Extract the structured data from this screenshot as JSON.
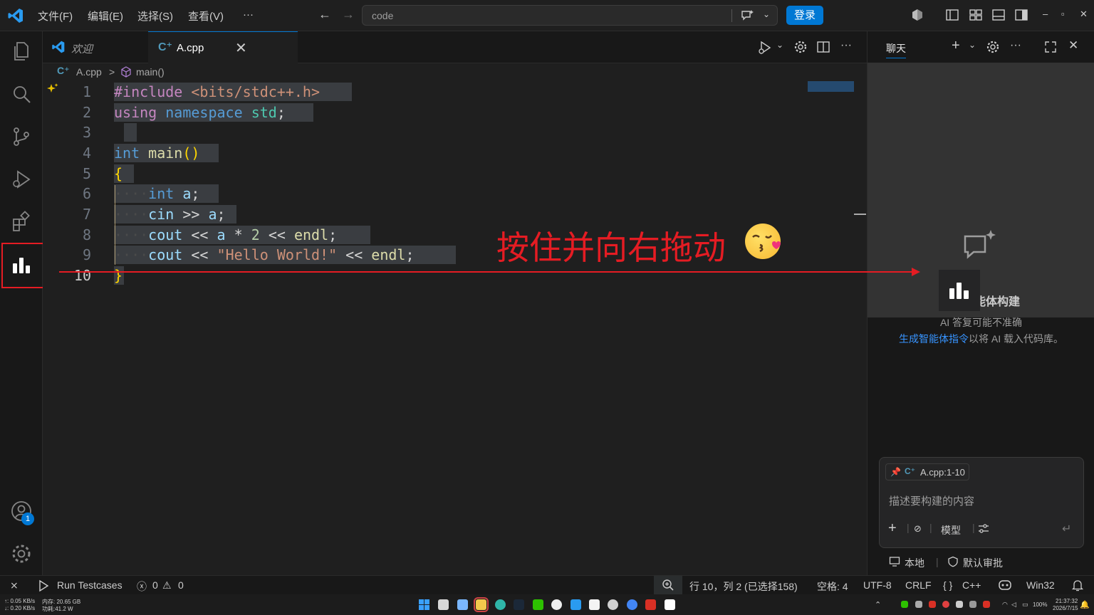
{
  "titlebar": {
    "menus": [
      "文件(F)",
      "编辑(E)",
      "选择(S)",
      "查看(V)"
    ],
    "more": "···",
    "search_placeholder": "code",
    "login_label": "登录",
    "window_controls": [
      "–",
      "▫",
      "✕"
    ]
  },
  "activitybar": {
    "items": [
      "explorer-icon",
      "search-icon",
      "source-control-icon",
      "run-debug-icon",
      "extensions-icon",
      "chart-icon"
    ],
    "account_badge": "1"
  },
  "tabs": [
    {
      "label": "欢迎",
      "active": false
    },
    {
      "label": "A.cpp",
      "active": true,
      "close": "✕"
    }
  ],
  "breadcrumb": {
    "file": "A.cpp",
    "sep": ">",
    "symbol": "main()"
  },
  "editor": {
    "line_numbers": [
      "1",
      "2",
      "3",
      "4",
      "5",
      "6",
      "7",
      "8",
      "9",
      "10"
    ],
    "code": {
      "l1a": "#include",
      "l1b": "<bits/stdc++.h>",
      "l2a": "using",
      "l2b": "namespace",
      "l2c": "std",
      "l2d": ";",
      "l4a": "int",
      "l4b": "main",
      "l4c": "()",
      "l5": "{",
      "l6a": "int",
      "l6b": "a",
      "l6c": ";",
      "l7a": "cin",
      "l7b": ">>",
      "l7c": "a",
      "l7d": ";",
      "l8a": "cout",
      "l8b": "<<",
      "l8c": "a",
      "l8d": "*",
      "l8e": "2",
      "l8f": "<<",
      "l8g": "endl",
      "l8h": ";",
      "l9a": "cout",
      "l9b": "<<",
      "l9c": "\"Hello World!\"",
      "l9d": "<<",
      "l9e": "endl",
      "l9f": ";",
      "l10": "}",
      "indent": "····"
    }
  },
  "annotation": {
    "text": "按住并向右拖动"
  },
  "chat": {
    "title": "聊天",
    "build_label": "使用智能体构建",
    "note": "AI 答复可能不准确",
    "link": "生成智能体指令",
    "link_suffix": "以将 AI 载入代码库。",
    "context_chip": "A.cpp:1-10",
    "input_placeholder": "描述要构建的内容",
    "model_label": "模型",
    "footer_local": "本地",
    "footer_approve": "默认审批"
  },
  "statusbar": {
    "run_testcases": "Run Testcases",
    "errors": "0",
    "warnings": "0",
    "position": "行 10，列 2 (已选择158)",
    "spaces": "空格: 4",
    "encoding": "UTF-8",
    "eol": "CRLF",
    "language": "C++",
    "platform": "Win32"
  },
  "taskbar": {
    "net_up": "↑: 0.05 KB/s",
    "net_down": "↓: 0.20 KB/s",
    "mem": "内存: 20.65 GB",
    "power": "功耗:41.2 W",
    "battery": "100%",
    "time": "21:37:32",
    "date": "2026/7/15"
  }
}
